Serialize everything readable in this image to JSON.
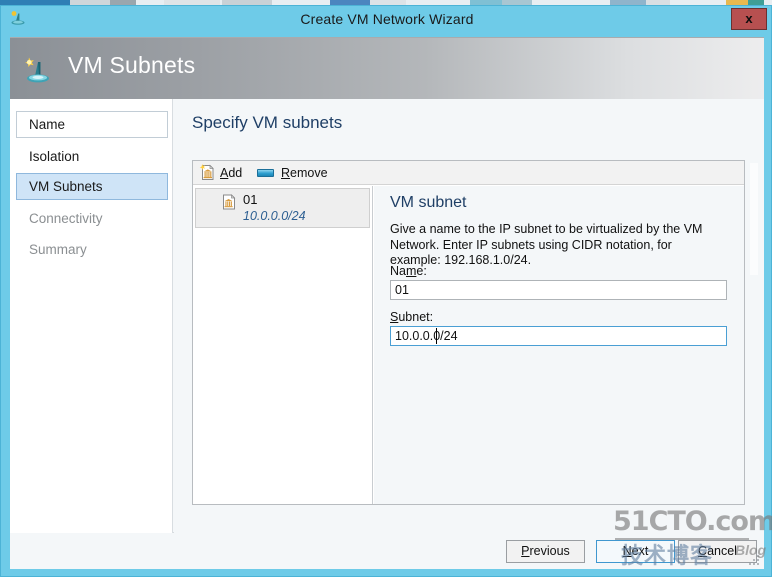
{
  "window": {
    "title": "Create VM Network Wizard",
    "close_label": "x",
    "titlebar_icon": "vm-network-icon",
    "accent_color": "#6ecbe8",
    "close_color": "#b75050"
  },
  "banner": {
    "title": "VM Subnets",
    "icon": "vm-subnet-icon"
  },
  "sidebar": {
    "items": [
      {
        "label": "Name",
        "state": "done"
      },
      {
        "label": "Isolation",
        "state": "plain"
      },
      {
        "label": "VM Subnets",
        "state": "selected"
      },
      {
        "label": "Connectivity",
        "state": "disabled"
      },
      {
        "label": "Summary",
        "state": "disabled"
      }
    ]
  },
  "main": {
    "heading": "Specify VM subnets",
    "toolbar": {
      "add": {
        "pre": "",
        "mnemonic": "A",
        "post": "dd",
        "icon": "add-subnet-icon"
      },
      "remove": {
        "pre": "",
        "mnemonic": "R",
        "post": "emove",
        "icon": "remove-icon"
      }
    },
    "list": {
      "items": [
        {
          "name": "01",
          "subnet": "10.0.0.0/24",
          "icon": "subnet-icon",
          "selected": true
        }
      ]
    },
    "detail": {
      "title": "VM subnet",
      "description": "Give a name to the IP subnet to be virtualized by the VM Network. Enter IP subnets using CIDR notation, for example: 192.168.1.0/24.",
      "fields": {
        "name": {
          "label_pre": "Na",
          "label_mnemonic": "m",
          "label_post": "e:",
          "value": "01",
          "focused": false
        },
        "subnet": {
          "label_pre": "",
          "label_mnemonic": "S",
          "label_post": "ubnet:",
          "value": "10.0.0.0/24",
          "focused": true
        }
      }
    }
  },
  "footer": {
    "previous": {
      "pre": "",
      "mnemonic": "P",
      "post": "revious"
    },
    "next": {
      "pre": "",
      "mnemonic": "N",
      "post": "ext"
    },
    "cancel": {
      "pre": "",
      "mnemonic": "C",
      "post": "ancel"
    }
  },
  "watermark": {
    "main": "51CTO.com",
    "cn": "技术博客",
    "blog": "Blog"
  }
}
